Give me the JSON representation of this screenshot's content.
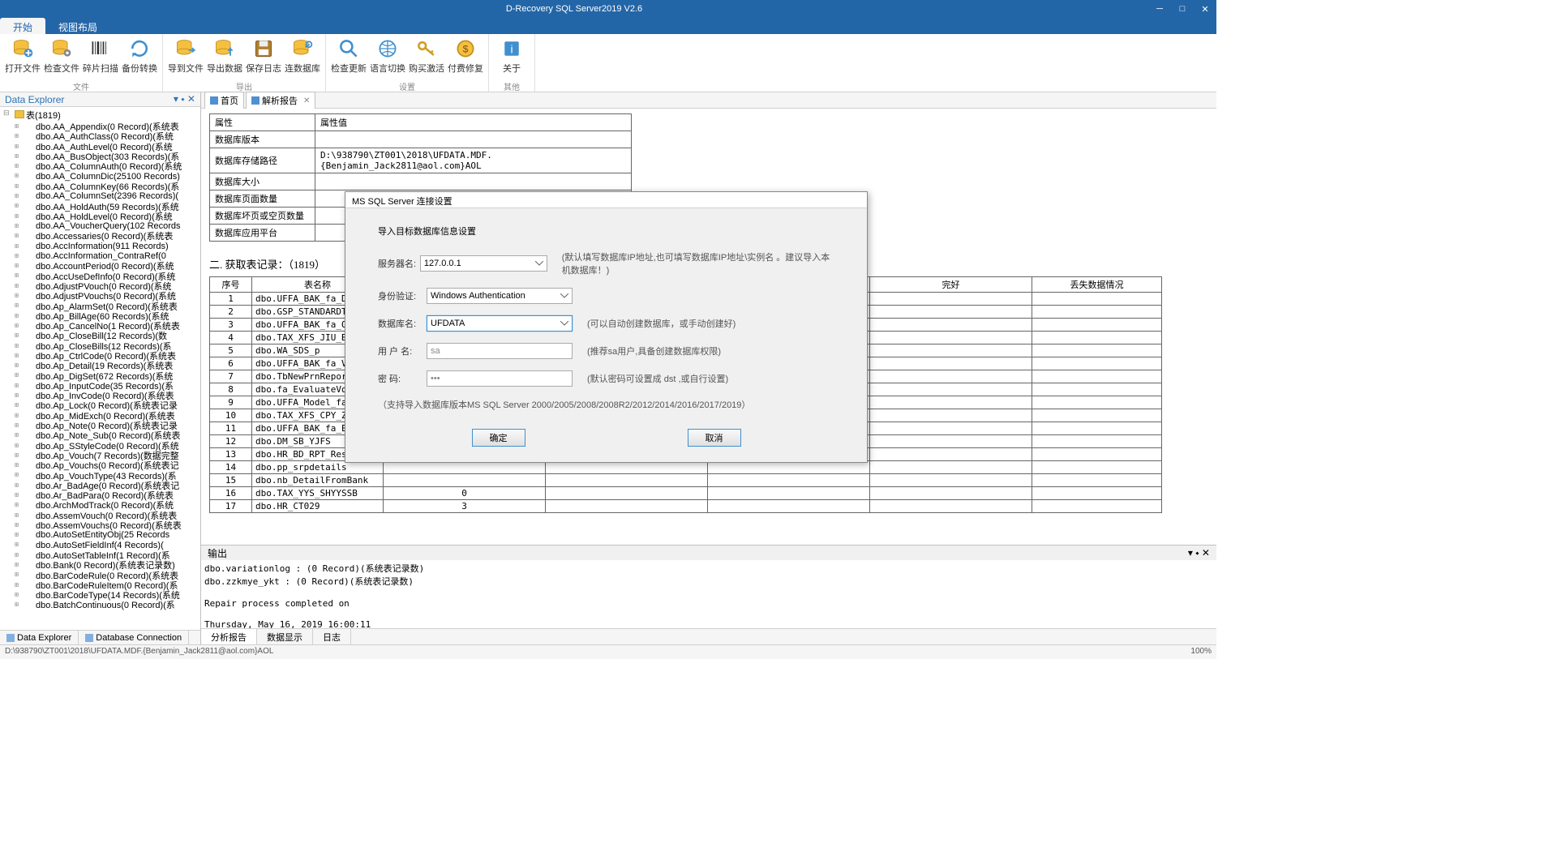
{
  "title": "D-Recovery SQL Server2019 V2.6",
  "menutabs": {
    "start": "开始",
    "view": "视图布局"
  },
  "ribbon": {
    "groups": [
      {
        "cap": "文件",
        "btns": [
          {
            "name": "open-file",
            "lbl": "打开文件",
            "ic": "db-plus"
          },
          {
            "name": "check-file",
            "lbl": "检查文件",
            "ic": "db-gear"
          },
          {
            "name": "frag-scan",
            "lbl": "碎片扫描",
            "ic": "barcode"
          },
          {
            "name": "backup-convert",
            "lbl": "备份转换",
            "ic": "refresh"
          }
        ]
      },
      {
        "cap": "导出",
        "btns": [
          {
            "name": "to-file",
            "lbl": "导到文件",
            "ic": "db-right"
          },
          {
            "name": "export-db",
            "lbl": "导出数据",
            "ic": "db-up"
          },
          {
            "name": "save-log",
            "lbl": "保存日志",
            "ic": "disk"
          },
          {
            "name": "connect-db",
            "lbl": "连数据库",
            "ic": "db-link"
          }
        ]
      },
      {
        "cap": "设置",
        "btns": [
          {
            "name": "check-update",
            "lbl": "检查更新",
            "ic": "magnify"
          },
          {
            "name": "lang",
            "lbl": "语言切换",
            "ic": "globe"
          },
          {
            "name": "buy",
            "lbl": "购买激活",
            "ic": "key"
          },
          {
            "name": "paid-repair",
            "lbl": "付费修复",
            "ic": "coin"
          }
        ]
      },
      {
        "cap": "其他",
        "btns": [
          {
            "name": "about",
            "lbl": "关于",
            "ic": "info"
          }
        ]
      }
    ]
  },
  "explorer": {
    "title": "Data Explorer",
    "root": "表(1819)",
    "nodes": [
      "dbo.AA_Appendix(0 Record)(系统表",
      "dbo.AA_AuthClass(0 Record)(系统",
      "dbo.AA_AuthLevel(0 Record)(系统",
      "dbo.AA_BusObject(303 Records)(系",
      "dbo.AA_ColumnAuth(0 Record)(系统",
      "dbo.AA_ColumnDic(25100 Records)",
      "dbo.AA_ColumnKey(66 Records)(系",
      "dbo.AA_ColumnSet(2396 Records)(",
      "dbo.AA_HoldAuth(59 Records)(系统",
      "dbo.AA_HoldLevel(0 Record)(系统",
      "dbo.AA_VoucherQuery(102 Records",
      "dbo.Accessaries(0 Record)(系统表",
      "dbo.AccInformation(911 Records)",
      "dbo.AccInformation_ContraRef(0",
      "dbo.AccountPeriod(0 Record)(系统",
      "dbo.AccUseDefInfo(0 Record)(系统",
      "dbo.AdjustPVouch(0 Record)(系统",
      "dbo.AdjustPVouchs(0 Record)(系统",
      "dbo.Ap_AlarmSet(0 Record)(系统表",
      "dbo.Ap_BillAge(60 Records)(系统",
      "dbo.Ap_CancelNo(1 Record)(系统表",
      "dbo.Ap_CloseBill(12 Records)(数",
      "dbo.Ap_CloseBills(12 Records)(系",
      "dbo.Ap_CtrlCode(0 Record)(系统表",
      "dbo.Ap_Detail(19 Records)(系统表",
      "dbo.Ap_DigSet(672 Records)(系统",
      "dbo.Ap_InputCode(35 Records)(系",
      "dbo.Ap_InvCode(0 Record)(系统表",
      "dbo.Ap_Lock(0 Record)(系统表记录",
      "dbo.Ap_MidExch(0 Record)(系统表",
      "dbo.Ap_Note(0 Record)(系统表记录",
      "dbo.Ap_Note_Sub(0 Record)(系统表",
      "dbo.Ap_SStyleCode(0 Record)(系统",
      "dbo.Ap_Vouch(7 Records)(数据完整",
      "dbo.Ap_Vouchs(0 Record)(系统表记",
      "dbo.Ap_VouchType(43 Records)(系",
      "dbo.Ar_BadAge(0 Record)(系统表记",
      "dbo.Ar_BadPara(0 Record)(系统表",
      "dbo.ArchModTrack(0 Record)(系统",
      "dbo.AssemVouch(0 Record)(系统表",
      "dbo.AssemVouchs(0 Record)(系统表",
      "dbo.AutoSetEntityObj(25 Records",
      "dbo.AutoSetFieldInf(4 Records)(",
      "dbo.AutoSetTableInf(1 Record)(系",
      "dbo.Bank(0 Record)(系统表记录数)",
      "dbo.BarCodeRule(0 Record)(系统表",
      "dbo.BarCodeRuleItem(0 Record)(系",
      "dbo.BarCodeType(14 Records)(系统",
      "dbo.BatchContinuous(0 Record)(系"
    ],
    "tabs": {
      "a": "Data Explorer",
      "b": "Database Connection"
    }
  },
  "doctabs": {
    "home": "首页",
    "report": "解析报告"
  },
  "propTable": {
    "h1": "属性",
    "h2": "属性值",
    "rows": [
      [
        "数据库版本",
        ""
      ],
      [
        "数据库存储路径",
        "D:\\938790\\ZT001\\2018\\UFDATA.MDF.{Benjamin_Jack2811@aol.com}AOL"
      ],
      [
        "数据库大小",
        ""
      ],
      [
        "数据库页面数量",
        ""
      ],
      [
        "数据库坏页或空页数量",
        ""
      ],
      [
        "数据库应用平台",
        ""
      ]
    ]
  },
  "section2": "二. 获取表记录：（1819）",
  "rtbl": {
    "hdr": [
      "序号",
      "表名称",
      "",
      "",
      "",
      "完好",
      "丢失数据情况"
    ],
    "rows": [
      [
        "1",
        "dbo.UFFA_BAK_fa_DeprI",
        "",
        "",
        "",
        "",
        ""
      ],
      [
        "2",
        "dbo.GSP_STANDARDTYPE",
        "",
        "",
        "",
        "",
        ""
      ],
      [
        "3",
        "dbo.UFFA_BAK_fa_Origi",
        "",
        "",
        "",
        "",
        ""
      ],
      [
        "4",
        "dbo.TAX_XFS_JIU_BQZYD",
        "",
        "",
        "",
        "",
        ""
      ],
      [
        "5",
        "dbo.WA_SDS_p",
        "",
        "",
        "",
        "",
        ""
      ],
      [
        "6",
        "dbo.UFFA_BAK_fa_Vouch",
        "",
        "",
        "",
        "",
        ""
      ],
      [
        "7",
        "dbo.TbNewPrnReportInf",
        "",
        "",
        "",
        "",
        ""
      ],
      [
        "8",
        "dbo.fa_EvaluateVouche",
        "",
        "",
        "",
        "",
        ""
      ],
      [
        "9",
        "dbo.UFFA_Model_fa_Ite",
        "",
        "",
        "",
        "",
        ""
      ],
      [
        "10",
        "dbo.TAX_XFS_CPY_ZBMX",
        "",
        "",
        "",
        "",
        ""
      ],
      [
        "11",
        "dbo.UFFA_BAK_fa_Evalu",
        "",
        "",
        "",
        "",
        ""
      ],
      [
        "12",
        "dbo.DM_SB_YJFS",
        "",
        "",
        "",
        "",
        ""
      ],
      [
        "13",
        "dbo.HR_BD_RPT_ResultD",
        "",
        "",
        "",
        "",
        ""
      ],
      [
        "14",
        "dbo.pp_srpdetails",
        "",
        "",
        "",
        "",
        ""
      ],
      [
        "15",
        "dbo.nb_DetailFromBank",
        "",
        "",
        "",
        "",
        ""
      ],
      [
        "16",
        "dbo.TAX_YYS_SHYYSSB",
        "0",
        "",
        "",
        "",
        ""
      ],
      [
        "17",
        "dbo.HR_CT029",
        "3",
        "",
        "",
        "",
        ""
      ]
    ]
  },
  "output": {
    "title": "输出",
    "body": "dbo.variationlog : (0 Record)(系统表记录数)\ndbo.zzkmye_ykt : (0 Record)(系统表记录数)\n\nRepair process completed on\n\nThursday, May 16, 2019 16:00:11",
    "tabs": [
      "分析报告",
      "数据显示",
      "日志"
    ]
  },
  "status": {
    "path": "D:\\938790\\ZT001\\2018\\UFDATA.MDF.{Benjamin_Jack2811@aol.com}AOL",
    "pct": "100%"
  },
  "dialog": {
    "title": "MS SQL Server 连接设置",
    "hdr": "导入目标数据库信息设置",
    "rows": {
      "server": {
        "lbl": "服务器名:",
        "val": "127.0.0.1",
        "hint": "(默认填写数据库IP地址,也可填写数据库IP地址\\实例名 。建议导入本机数据库！)"
      },
      "auth": {
        "lbl": "身份验证:",
        "val": "Windows Authentication",
        "hint": ""
      },
      "db": {
        "lbl": "数据库名:",
        "val": "UFDATA",
        "hint": "(可以自动创建数据库，或手动创建好)"
      },
      "user": {
        "lbl": "用 户 名:",
        "val": "sa",
        "hint": "(推荐sa用户,具备创建数据库权限)"
      },
      "pwd": {
        "lbl": "密    码:",
        "val": "•••",
        "hint": "(默认密码可设置成 dst ,或自行设置)"
      }
    },
    "note": "（支持导入数据库版本MS SQL Server 2000/2005/2008/2008R2/2012/2014/2016/2017/2019）",
    "ok": "确定",
    "cancel": "取消"
  }
}
